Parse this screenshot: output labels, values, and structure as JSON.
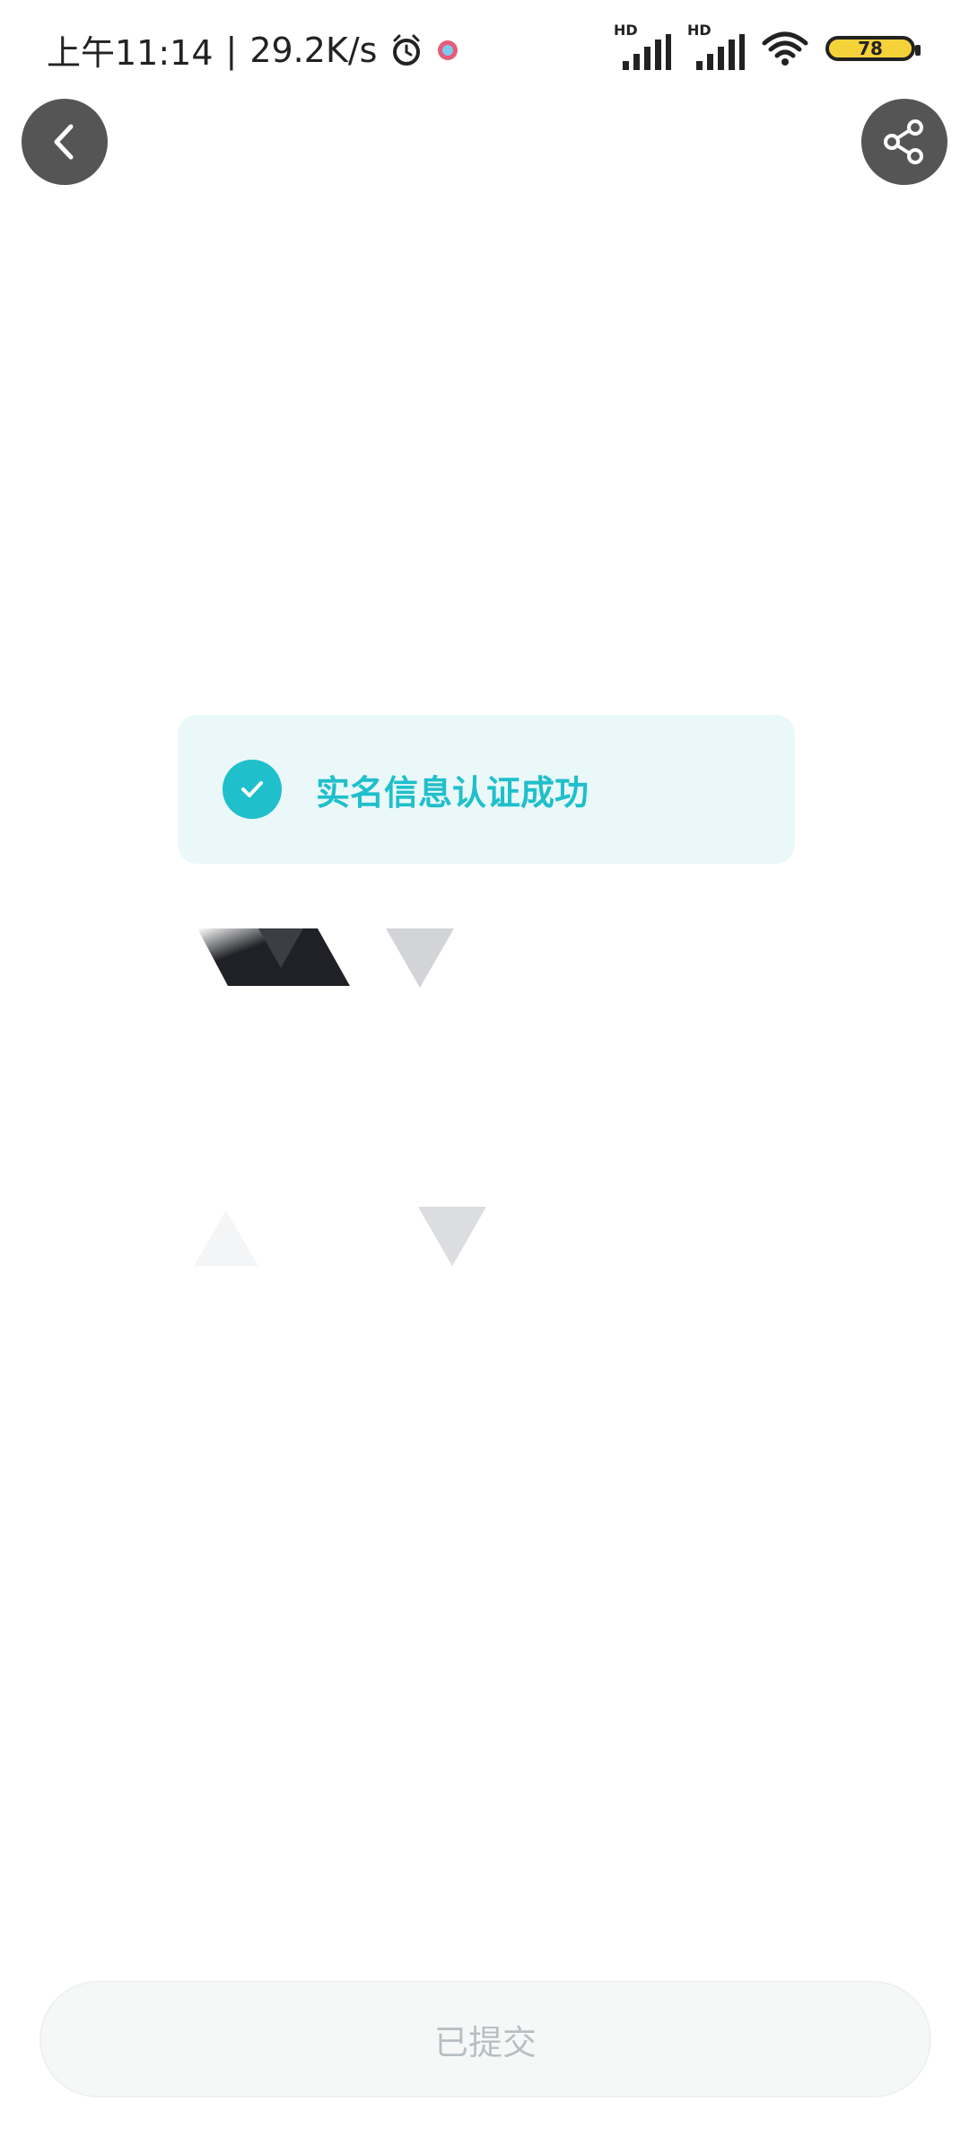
{
  "status_bar": {
    "time": "上午11:14",
    "separator": "|",
    "speed": "29.2K/s",
    "hd1": "HD",
    "hd2": "HD",
    "battery": "78"
  },
  "icons": {
    "back": "chevron-left-icon",
    "share": "share-icon",
    "success": "check-icon",
    "alarm": "alarm-icon"
  },
  "success": {
    "text": "实名信息认证成功"
  },
  "button": {
    "submitted": "已提交"
  },
  "colors": {
    "accent": "#1fbfcb",
    "card_bg": "#eaf8fa",
    "button_bg": "#f6f8f8",
    "button_text": "#b8bfc2"
  }
}
